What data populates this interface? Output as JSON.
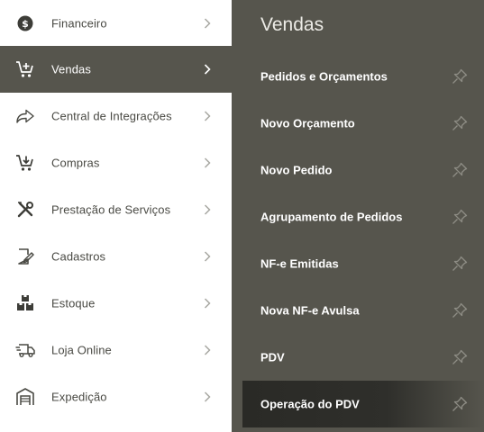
{
  "menu": {
    "items": [
      {
        "label": "Financeiro",
        "icon": "dollar-circle-icon"
      },
      {
        "label": "Vendas",
        "icon": "cart-add-icon",
        "active": true
      },
      {
        "label": "Central de Integrações",
        "icon": "share-arrow-icon"
      },
      {
        "label": "Compras",
        "icon": "cart-download-icon"
      },
      {
        "label": "Prestação de Serviços",
        "icon": "tools-icon"
      },
      {
        "label": "Cadastros",
        "icon": "edit-document-icon"
      },
      {
        "label": "Estoque",
        "icon": "boxes-icon"
      },
      {
        "label": "Loja Online",
        "icon": "delivery-truck-icon"
      },
      {
        "label": "Expedição",
        "icon": "warehouse-icon"
      }
    ]
  },
  "submenu": {
    "title": "Vendas",
    "items": [
      {
        "label": "Pedidos e Orçamentos"
      },
      {
        "label": "Novo Orçamento"
      },
      {
        "label": "Novo Pedido"
      },
      {
        "label": "Agrupamento de Pedidos"
      },
      {
        "label": "NF-e Emitidas"
      },
      {
        "label": "Nova NF-e Avulsa"
      },
      {
        "label": "PDV"
      },
      {
        "label": "Operação do PDV",
        "active": true
      }
    ]
  },
  "colors": {
    "active_bg": "#56554d",
    "panel_bg": "#56554d",
    "text_dark": "#4a4a44",
    "text_light": "#ffffff"
  }
}
